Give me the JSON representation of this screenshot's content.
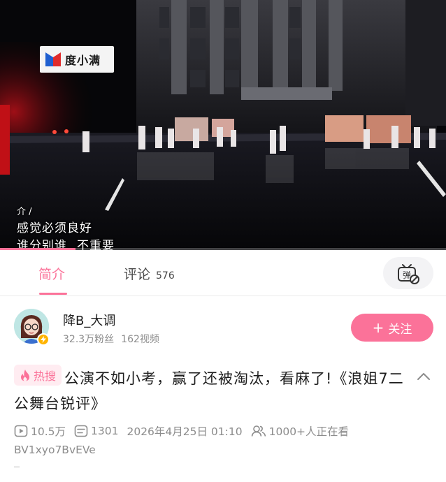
{
  "video": {
    "sponsor_text": "度小满",
    "subtitles": {
      "small": "介 /",
      "line1": "感觉必须良好",
      "line2a": "谁分别谁",
      "line2b": "不重要"
    }
  },
  "tabs": {
    "intro_label": "简介",
    "comments_label": "评论",
    "comments_count": "576",
    "danmaku_icon": "danmaku-off-icon"
  },
  "uploader": {
    "name": "降B_大调",
    "followers": "32.3万粉丝",
    "videos": "162视频",
    "follow_label": "关注"
  },
  "title": {
    "badge": "热搜",
    "text": "公演不如小考，赢了还被淘汰，看麻了!《浪姐7二公舞台锐评》"
  },
  "meta": {
    "views": "10.5万",
    "danmaku": "1301",
    "date": "2026年4月25日 01:10",
    "watching": "1000+人正在看",
    "bvid": "BV1xyo7BvEVe"
  },
  "colors": {
    "accent": "#fb7299",
    "badge_bg": "#ffecf1",
    "muted": "#8c8c8c"
  }
}
